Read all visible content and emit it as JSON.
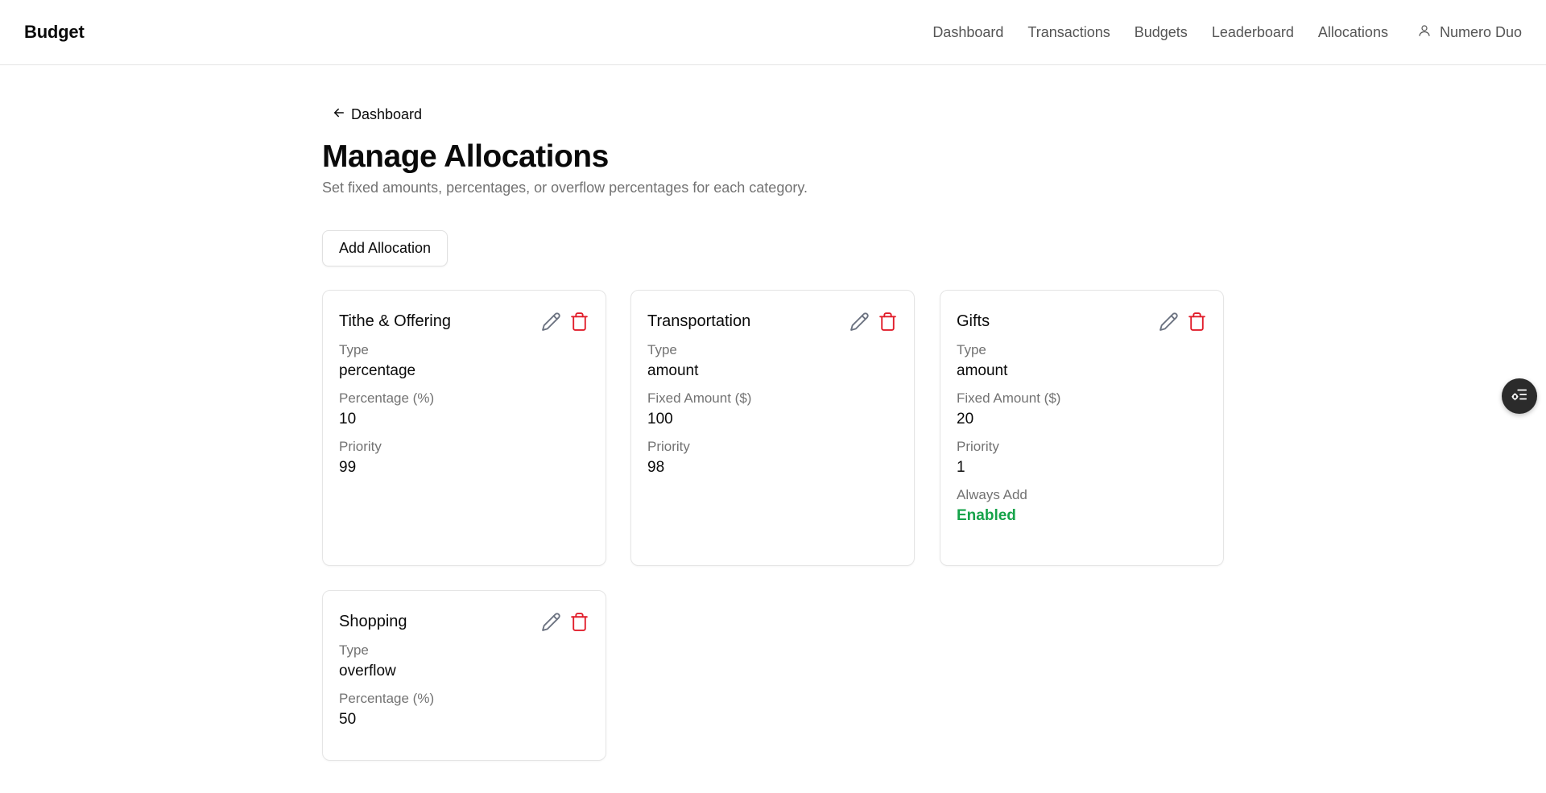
{
  "app": {
    "brand": "Budget"
  },
  "nav": {
    "items": [
      "Dashboard",
      "Transactions",
      "Budgets",
      "Leaderboard",
      "Allocations"
    ],
    "user": "Numero Duo"
  },
  "page": {
    "back_label": "Dashboard",
    "title": "Manage Allocations",
    "subtitle": "Set fixed amounts, percentages, or overflow percentages for each category.",
    "add_button": "Add Allocation"
  },
  "cards": [
    {
      "name": "Tithe & Offering",
      "fields": [
        {
          "label": "Type",
          "value": "percentage"
        },
        {
          "label": "Percentage (%)",
          "value": "10"
        },
        {
          "label": "Priority",
          "value": "99"
        }
      ]
    },
    {
      "name": "Transportation",
      "fields": [
        {
          "label": "Type",
          "value": "amount"
        },
        {
          "label": "Fixed Amount ($)",
          "value": "100"
        },
        {
          "label": "Priority",
          "value": "98"
        }
      ]
    },
    {
      "name": "Gifts",
      "fields": [
        {
          "label": "Type",
          "value": "amount"
        },
        {
          "label": "Fixed Amount ($)",
          "value": "20"
        },
        {
          "label": "Priority",
          "value": "1"
        },
        {
          "label": "Always Add",
          "value": "Enabled"
        }
      ]
    },
    {
      "name": "Shopping",
      "fields": [
        {
          "label": "Type",
          "value": "overflow"
        },
        {
          "label": "Percentage (%)",
          "value": "50"
        }
      ]
    }
  ],
  "icons": {
    "edit": "pencil-icon",
    "delete": "trash-icon",
    "user": "user-icon",
    "back": "arrow-left-icon",
    "fab": "list-settings-icon"
  },
  "colors": {
    "delete": "#e11d2a",
    "enabled": "#16a34a",
    "edit": "#6b7280"
  }
}
